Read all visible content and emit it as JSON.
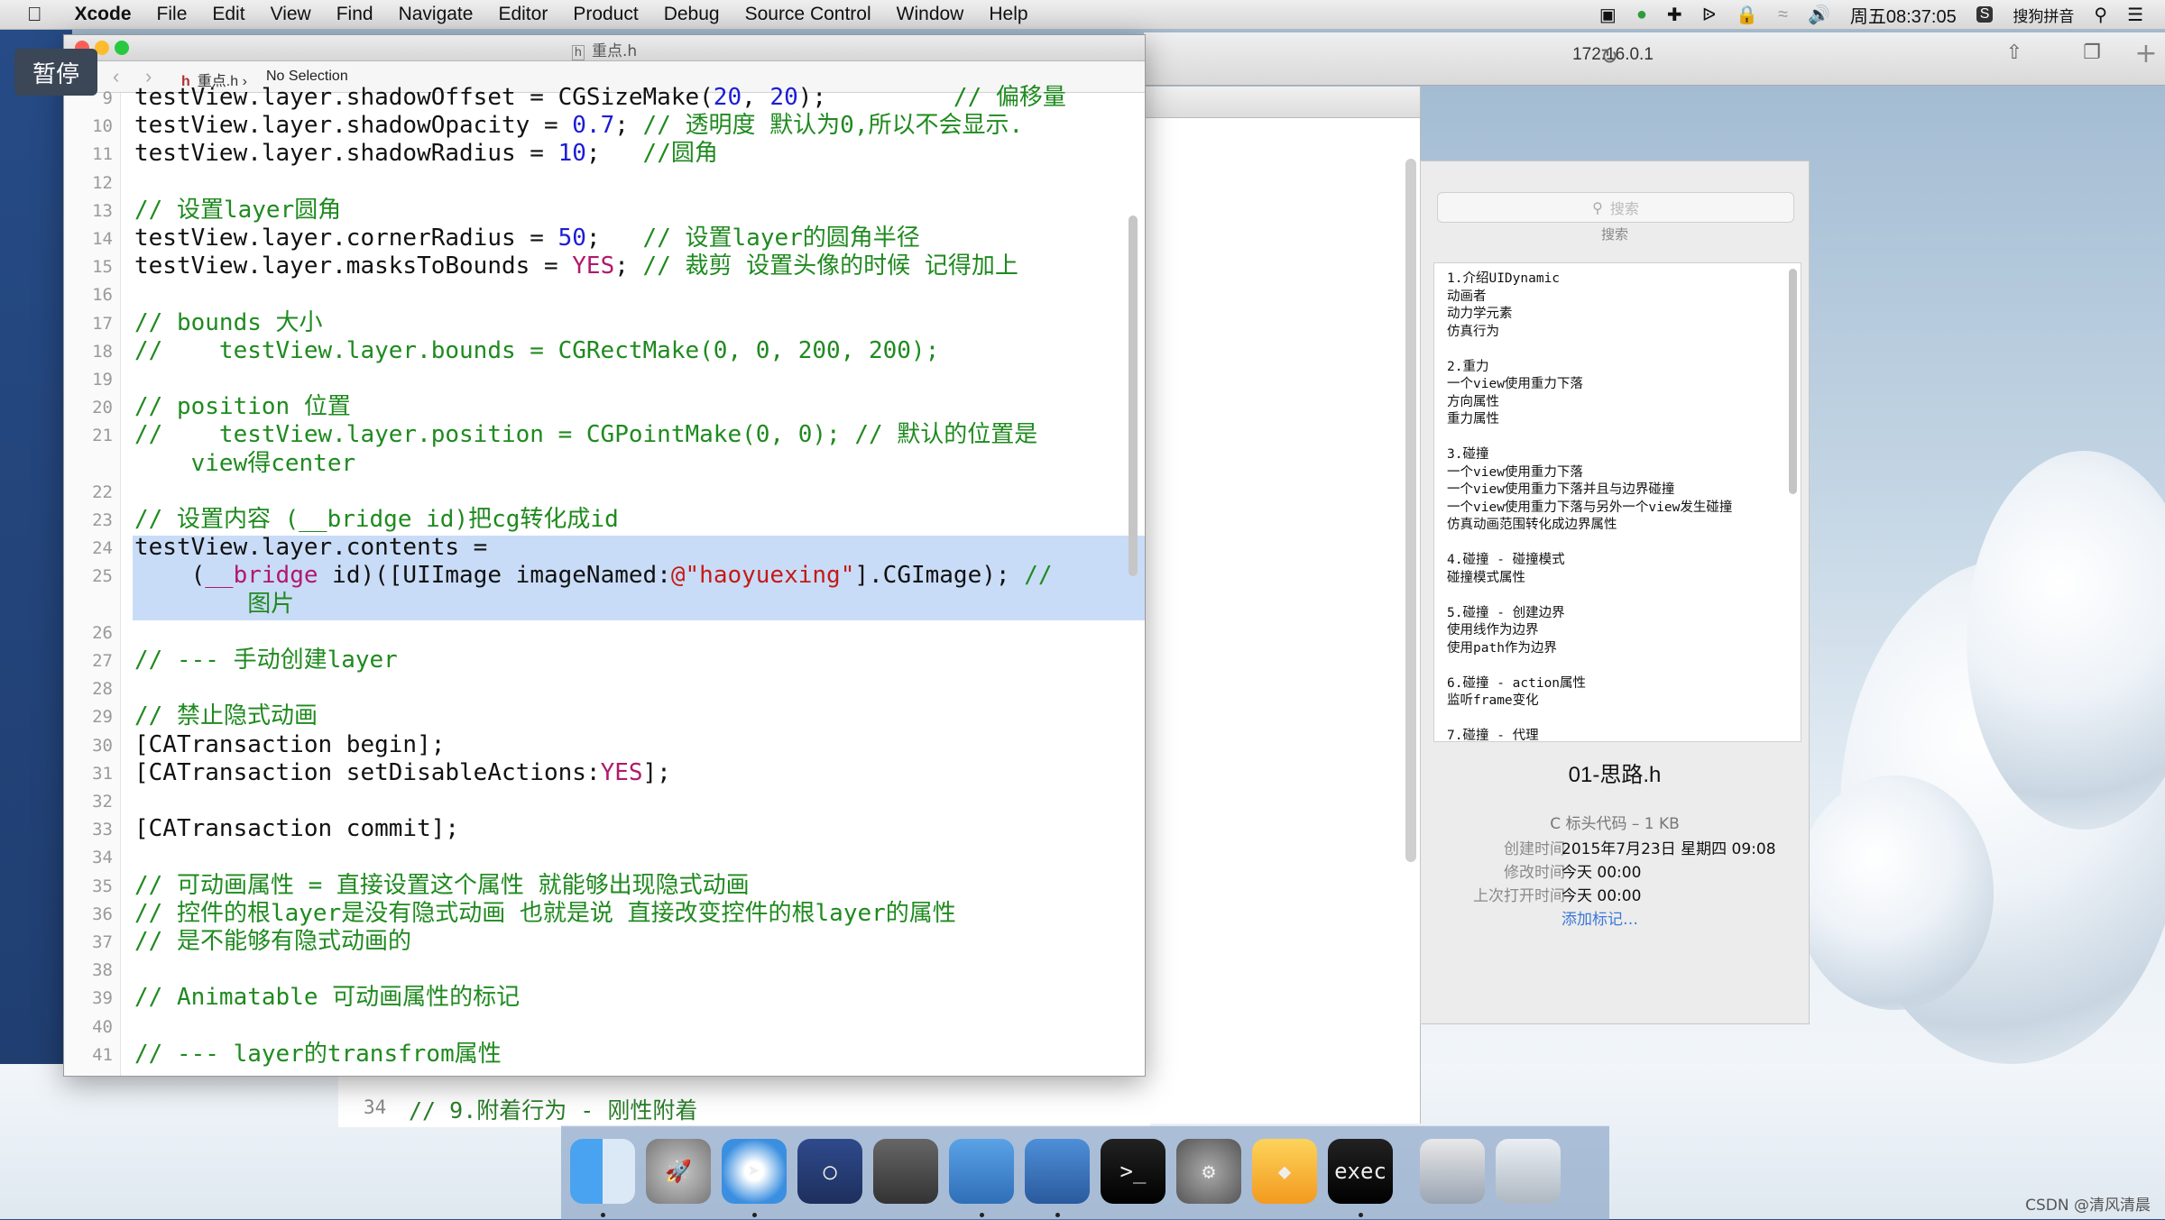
{
  "menubar": {
    "apple": "",
    "app_name": "Xcode",
    "items": [
      "File",
      "Edit",
      "View",
      "Find",
      "Navigate",
      "Editor",
      "Product",
      "Debug",
      "Source Control",
      "Window",
      "Help"
    ],
    "clock": "周五08:37:05",
    "input_method": "搜狗拼音"
  },
  "pause_badge": "暂停",
  "browser": {
    "url": "172.16.0.1"
  },
  "xcode": {
    "title": "重点.h",
    "jump_file": "重点.h",
    "jump_selection": "No Selection",
    "lines": [
      {
        "n": "9",
        "t": "testView.layer.shadowOffset = CGSizeMake(20, 20);         // 偏移量"
      },
      {
        "n": "10",
        "t": "testView.layer.shadowOpacity = 0.7; // 透明度 默认为0,所以不会显示."
      },
      {
        "n": "11",
        "t": "testView.layer.shadowRadius = 10;   //圆角"
      },
      {
        "n": "12",
        "t": ""
      },
      {
        "n": "13",
        "t": "// 设置layer圆角"
      },
      {
        "n": "14",
        "t": "testView.layer.cornerRadius = 50;   // 设置layer的圆角半径"
      },
      {
        "n": "15",
        "t": "testView.layer.masksToBounds = YES; // 裁剪 设置头像的时候 记得加上"
      },
      {
        "n": "16",
        "t": ""
      },
      {
        "n": "17",
        "t": "// bounds 大小"
      },
      {
        "n": "18",
        "t": "//    testView.layer.bounds = CGRectMake(0, 0, 200, 200);"
      },
      {
        "n": "19",
        "t": ""
      },
      {
        "n": "20",
        "t": "// position 位置"
      },
      {
        "n": "21",
        "t": "//    testView.layer.position = CGPointMake(0, 0); // 默认的位置是"
      },
      {
        "n": "",
        "t": "    view得center"
      },
      {
        "n": "22",
        "t": ""
      },
      {
        "n": "23",
        "t": "// 设置内容 (__bridge id)把cg转化成id"
      },
      {
        "n": "24",
        "t": "testView.layer.contents ="
      },
      {
        "n": "25",
        "t": "    (__bridge id)([UIImage imageNamed:@\"haoyuexing\"].CGImage); //"
      },
      {
        "n": "",
        "t": "        图片"
      },
      {
        "n": "26",
        "t": ""
      },
      {
        "n": "27",
        "t": "// --- 手动创建layer"
      },
      {
        "n": "28",
        "t": ""
      },
      {
        "n": "29",
        "t": "// 禁止隐式动画"
      },
      {
        "n": "30",
        "t": "[CATransaction begin];"
      },
      {
        "n": "31",
        "t": "[CATransaction setDisableActions:YES];"
      },
      {
        "n": "32",
        "t": ""
      },
      {
        "n": "33",
        "t": "[CATransaction commit];"
      },
      {
        "n": "34",
        "t": ""
      },
      {
        "n": "35",
        "t": "// 可动画属性 = 直接设置这个属性 就能够出现隐式动画"
      },
      {
        "n": "36",
        "t": "// 控件的根layer是没有隐式动画 也就是说 直接改变控件的根layer的属性"
      },
      {
        "n": "37",
        "t": "// 是不能够有隐式动画的"
      },
      {
        "n": "38",
        "t": ""
      },
      {
        "n": "39",
        "t": "// Animatable 可动画属性的标记"
      },
      {
        "n": "40",
        "t": ""
      },
      {
        "n": "41",
        "t": "// --- layer的transfrom属性"
      }
    ]
  },
  "back_window": {
    "line_num": "34",
    "line_text": "// 9.附着行为 - 刚性附着"
  },
  "finder": {
    "search_placeholder": "搜索",
    "search_label": "搜索",
    "preview_text": "1.介绍UIDynamic\n动画者\n动力学元素\n仿真行为\n\n2.重力\n一个view使用重力下落\n方向属性\n重力属性\n\n3.碰撞\n一个view使用重力下落\n一个view使用重力下落并且与边界碰撞\n一个view使用重力下落与另外一个view发生碰撞\n仿真动画范围转化成边界属性\n\n4.碰撞 - 碰撞模式\n碰撞模式属性\n\n5.碰撞 - 创建边界\n使用线作为边界\n使用path作为边界\n\n6.碰撞 - action属性\n监听frame变化\n\n7.碰撞 - 代理",
    "file_name": "01-思路.h",
    "kind": "C 标头代码 – 1 KB",
    "rows": [
      {
        "k": "创建时间",
        "v": "2015年7月23日 星期四 09:08"
      },
      {
        "k": "修改时间",
        "v": "今天 00:00"
      },
      {
        "k": "上次打开时间",
        "v": "今天 00:00"
      }
    ],
    "add_tags": "添加标记…"
  },
  "dock": {
    "icons": [
      "finder-icon",
      "launchpad-icon",
      "safari-icon",
      "mouse-app-icon",
      "photo-slideshow-icon",
      "xcode-icon",
      "instruments-icon",
      "terminal-icon",
      "system-preferences-icon",
      "sketch-icon",
      "exec-icon",
      "quicktime-icon",
      "trash-icon"
    ]
  },
  "watermark": "CSDN @清风清晨"
}
